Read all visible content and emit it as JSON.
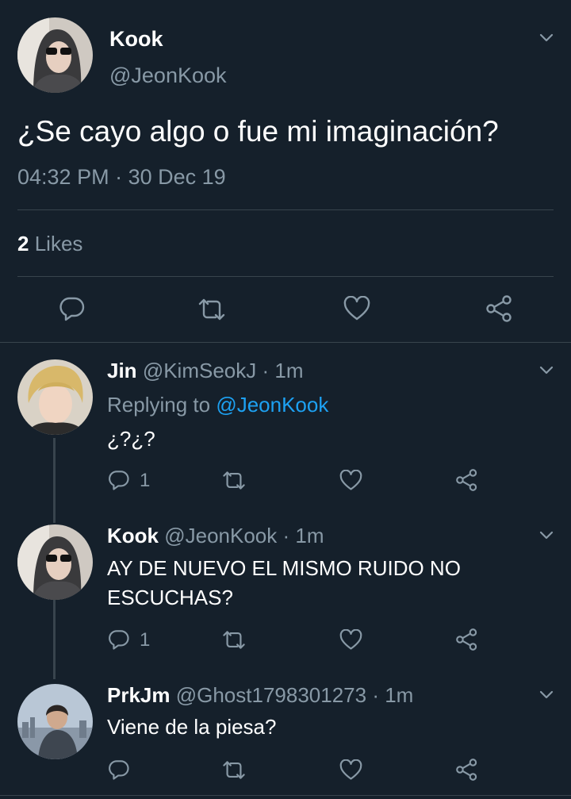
{
  "main_tweet": {
    "name": "Kook",
    "handle": "@JeonKook",
    "text": "¿Se cayo algo o fue mi imaginación?",
    "time": "04:32 PM",
    "separator": "·",
    "date": "30 Dec 19",
    "likes_count": "2",
    "likes_label": "Likes"
  },
  "replies": [
    {
      "name": "Jin",
      "handle": "@KimSeokJ",
      "time": "· 1m",
      "replying_prefix": "Replying to",
      "replying_handle": "@JeonKook",
      "text": "¿?¿?",
      "reply_count": "1"
    },
    {
      "name": "Kook",
      "handle": "@JeonKook",
      "time": "· 1m",
      "text_line1": "AY DE NUEVO EL MISMO RUIDO NO",
      "text_line2": "ESCUCHAS?",
      "reply_count": "1"
    },
    {
      "name": "PrkJm",
      "handle": "@Ghost1798301273",
      "time": "· 1m",
      "text": "Viene de la piesa?"
    }
  ],
  "icons": [
    "chevron-down-icon",
    "reply-icon",
    "retweet-icon",
    "like-icon",
    "share-icon"
  ],
  "colors": {
    "background": "#15202b",
    "muted": "#8899a6",
    "link": "#1da1f2",
    "divider": "#38444d"
  }
}
